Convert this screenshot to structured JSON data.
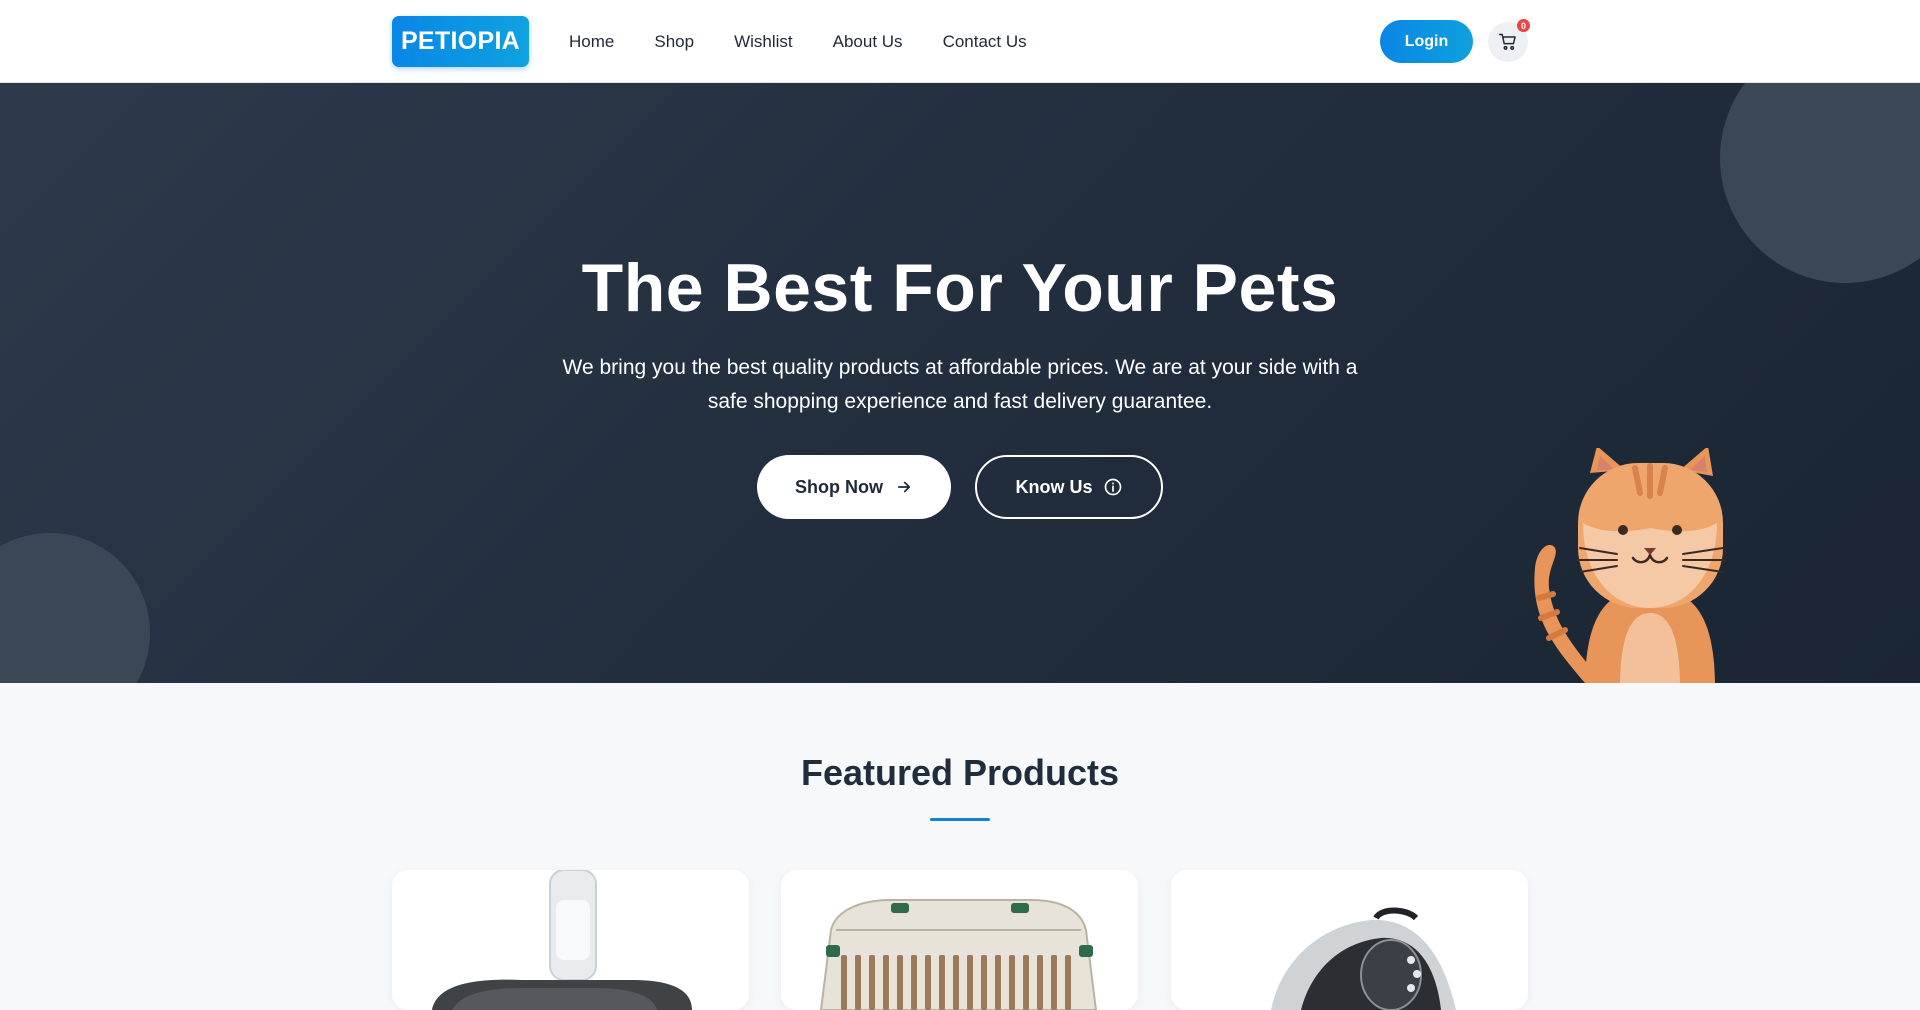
{
  "brand": {
    "logo_text": "PETIOPIA"
  },
  "nav": {
    "links": [
      "Home",
      "Shop",
      "Wishlist",
      "About Us",
      "Contact Us"
    ],
    "login_label": "Login",
    "cart_count": "0"
  },
  "hero": {
    "title": "The Best For Your Pets",
    "subtitle": "We bring you the best quality products at affordable prices. We are at your side with a safe shopping experience and fast delivery guarantee.",
    "primary_cta": "Shop Now",
    "secondary_cta": "Know Us"
  },
  "featured": {
    "title": "Featured Products",
    "products": [
      {
        "image": "water-dispenser-bowl"
      },
      {
        "image": "pet-carrier-crate"
      },
      {
        "image": "pet-backpack-carrier"
      }
    ]
  },
  "colors": {
    "accent": "#0a86e6",
    "hero_bg": "#222f3f",
    "badge": "#ef4444",
    "cat_orange": "#e8955a"
  },
  "icons": [
    "cart-icon",
    "arrow-right-icon",
    "info-circle-icon"
  ]
}
